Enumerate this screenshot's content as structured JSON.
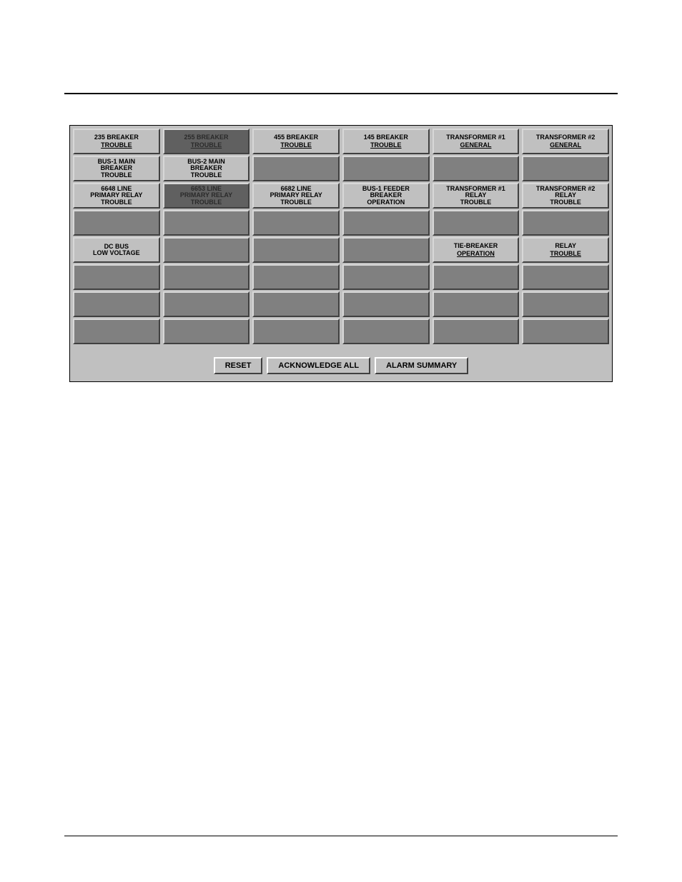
{
  "grid": {
    "rows": [
      [
        {
          "top": "235 BREAKER",
          "bot": "TROUBLE",
          "style": "light"
        },
        {
          "top": "255 BREAKER",
          "bot": "TROUBLE",
          "style": "dark"
        },
        {
          "top": "455 BREAKER",
          "bot": "TROUBLE",
          "style": "light"
        },
        {
          "top": "145 BREAKER",
          "bot": "TROUBLE",
          "style": "light"
        },
        {
          "top": "TRANSFORMER #1",
          "bot": "GENERAL",
          "style": "light"
        },
        {
          "top": "TRANSFORMER #2",
          "bot": "GENERAL",
          "style": "light"
        }
      ],
      [
        {
          "stack": "BUS-1 MAIN\nBREAKER\nTROUBLE",
          "style": "light"
        },
        {
          "stack": "BUS-2 MAIN\nBREAKER\nTROUBLE",
          "style": "light"
        },
        {
          "empty": true
        },
        {
          "empty": true
        },
        {
          "empty": true
        },
        {
          "empty": true
        }
      ],
      [
        {
          "stack": "6648 LINE\nPRIMARY RELAY\nTROUBLE",
          "style": "light"
        },
        {
          "stack": "6653 LINE\nPRIMARY RELAY\nTROUBLE",
          "style": "dark"
        },
        {
          "stack": "6682 LINE\nPRIMARY RELAY\nTROUBLE",
          "style": "light"
        },
        {
          "stack": "BUS-1 FEEDER\nBREAKER\nOPERATION",
          "style": "light"
        },
        {
          "stack": "TRANSFORMER #1\nRELAY\nTROUBLE",
          "style": "light"
        },
        {
          "stack": "TRANSFORMER #2\nRELAY\nTROUBLE",
          "style": "light"
        }
      ],
      [
        {
          "empty": true
        },
        {
          "empty": true
        },
        {
          "empty": true
        },
        {
          "empty": true
        },
        {
          "empty": true
        },
        {
          "empty": true
        }
      ],
      [
        {
          "stack": "DC BUS\nLOW VOLTAGE",
          "style": "light"
        },
        {
          "empty": true
        },
        {
          "empty": true
        },
        {
          "empty": true
        },
        {
          "top": "TIE-BREAKER",
          "bot": "OPERATION",
          "style": "light"
        },
        {
          "top": "RELAY",
          "bot": "TROUBLE",
          "style": "light"
        }
      ],
      [
        {
          "empty": true
        },
        {
          "empty": true
        },
        {
          "empty": true
        },
        {
          "empty": true
        },
        {
          "empty": true
        },
        {
          "empty": true
        }
      ],
      [
        {
          "empty": true
        },
        {
          "empty": true
        },
        {
          "empty": true
        },
        {
          "empty": true
        },
        {
          "empty": true
        },
        {
          "empty": true
        }
      ],
      [
        {
          "empty": true
        },
        {
          "empty": true
        },
        {
          "empty": true
        },
        {
          "empty": true
        },
        {
          "empty": true
        },
        {
          "empty": true
        }
      ]
    ]
  },
  "buttons": {
    "reset": "RESET",
    "ack": "ACKNOWLEDGE ALL",
    "summary": "ALARM SUMMARY"
  }
}
